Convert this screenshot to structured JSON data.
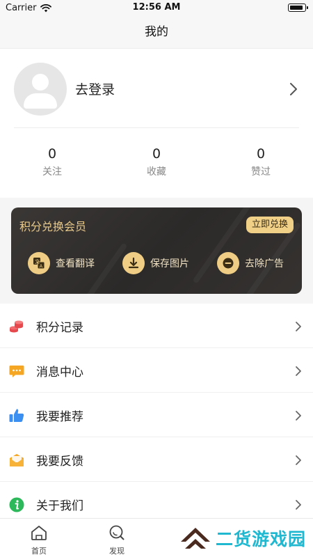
{
  "status_bar": {
    "carrier": "Carrier",
    "time": "12:56 AM"
  },
  "nav": {
    "title": "我的"
  },
  "profile": {
    "login_label": "去登录",
    "stats": [
      {
        "value": "0",
        "label": "关注"
      },
      {
        "value": "0",
        "label": "收藏"
      },
      {
        "value": "0",
        "label": "赞过"
      }
    ]
  },
  "vip_card": {
    "title": "积分兑换会员",
    "redeem_button": "立即兑换",
    "features": [
      {
        "icon": "translate-icon",
        "label": "查看翻译"
      },
      {
        "icon": "download-icon",
        "label": "保存图片"
      },
      {
        "icon": "minus-circle-icon",
        "label": "去除广告"
      }
    ]
  },
  "menu": [
    {
      "icon": "coins-icon",
      "label": "积分记录"
    },
    {
      "icon": "message-icon",
      "label": "消息中心"
    },
    {
      "icon": "thumbs-up-icon",
      "label": "我要推荐"
    },
    {
      "icon": "envelope-icon",
      "label": "我要反馈"
    },
    {
      "icon": "info-icon",
      "label": "关于我们"
    }
  ],
  "tab_bar": {
    "tabs": [
      {
        "icon": "home-icon",
        "label": "首页"
      },
      {
        "icon": "discover-icon",
        "label": "发现"
      }
    ]
  },
  "watermark": {
    "text": "二货游戏园"
  },
  "colors": {
    "card_gold": "#efcd84",
    "card_dark": "#2e2b2a",
    "watermark_cyan": "#1fb8d0",
    "watermark_brown": "#4a2a1e"
  }
}
